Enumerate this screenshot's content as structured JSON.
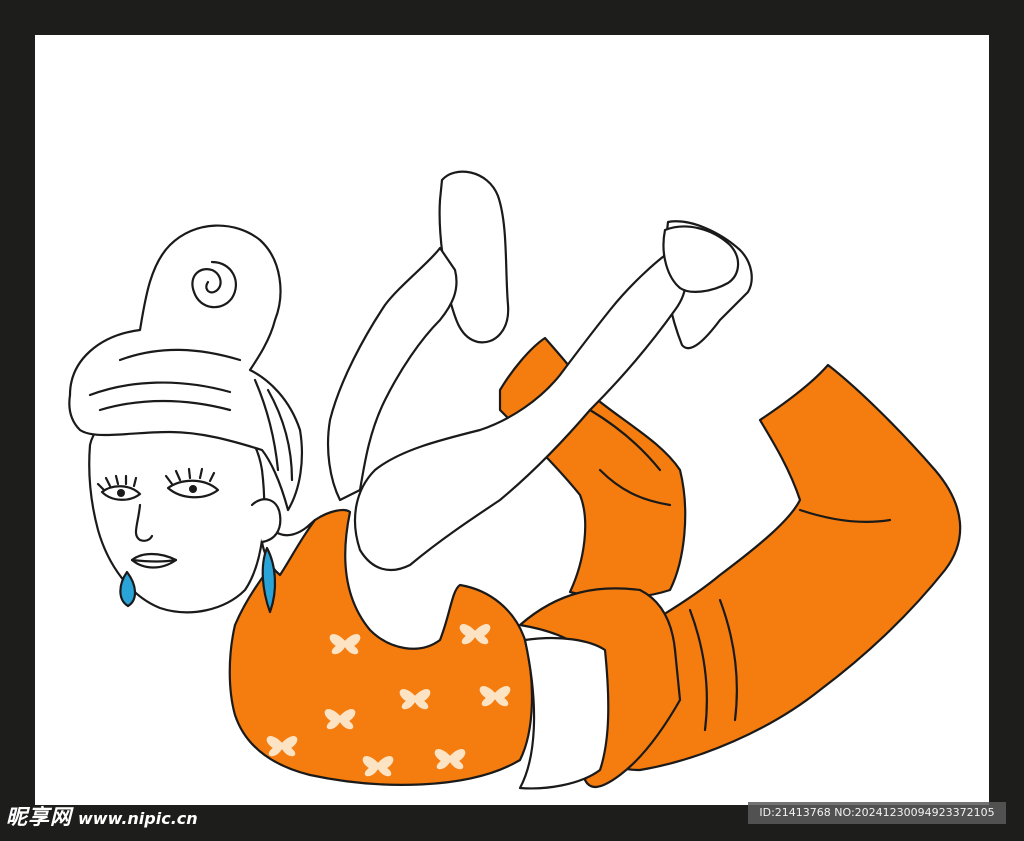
{
  "image": {
    "subject": "yoga woman in bow pose line illustration",
    "colors": {
      "frame": "#1d1d1b",
      "background": "#ffffff",
      "outfit": "#f57c0e",
      "outline": "#1a1a1a",
      "earring": "#2aa3d6",
      "butterfly": "#fbe3c4"
    }
  },
  "watermark": {
    "brand": "昵享网",
    "site": "www.nipic.cn"
  },
  "id_bar": {
    "text": "ID:21413768 NO:20241230094923372105"
  }
}
